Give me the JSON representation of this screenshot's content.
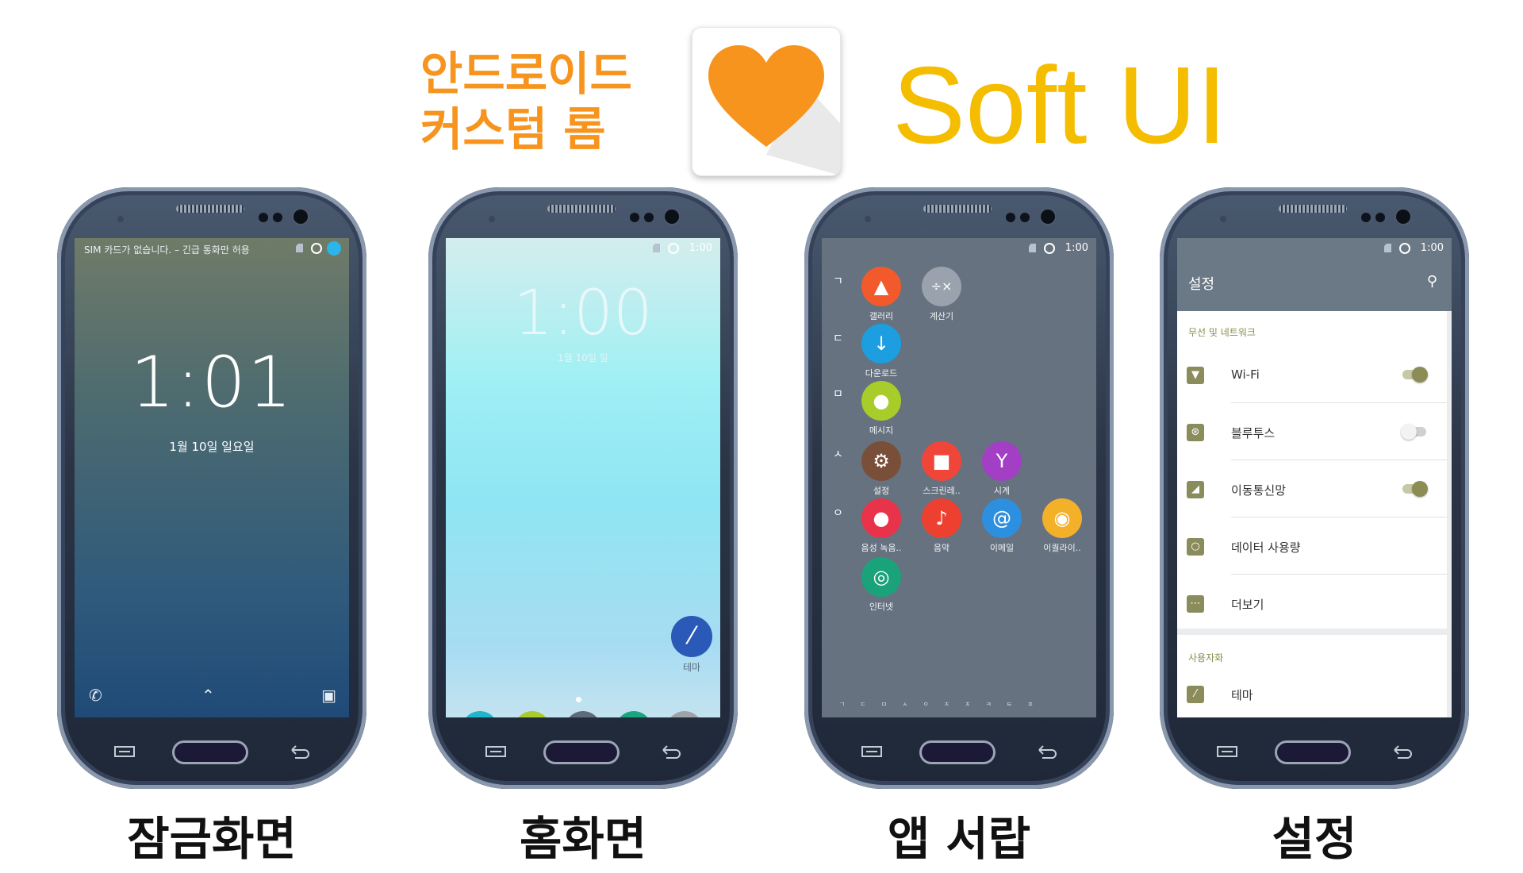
{
  "header": {
    "subtitle_line1": "안드로이드",
    "subtitle_line2": "커스텀 롬",
    "brand": "Soft UI",
    "logo_icon": "heart-icon",
    "accent_orange": "#f7941d",
    "brand_yellow": "#f5bd00"
  },
  "phones": [
    {
      "caption": "잠금화면",
      "lock": {
        "notice": "SIM 카드가 없습니다. – 긴급 통화만 허용",
        "time": "1:01",
        "date": "1월 10일 일요일"
      }
    },
    {
      "caption": "홈화면",
      "status_time": "1:00",
      "home": {
        "time": "1:00",
        "date": "1월 10일 일",
        "theme_label": "테마",
        "dock": [
          "phone-icon",
          "message-icon",
          "apps-icon",
          "browser-icon",
          "camera-icon"
        ]
      }
    },
    {
      "caption": "앱 서랍",
      "status_time": "1:00",
      "drawer": {
        "index": [
          "ㄱ",
          "ㄷ",
          "ㅁ",
          "ㅅ",
          "ㅇ"
        ],
        "apps": [
          {
            "label": "갤러리",
            "color": "#f25a2b"
          },
          {
            "label": "계산기",
            "color": "#9aa3ad"
          },
          {
            "label": "다운로드",
            "color": "#1c9ee0"
          },
          {
            "label": "메시지",
            "color": "#a8cc2a"
          },
          {
            "label": "설정",
            "color": "#7a4f3a"
          },
          {
            "label": "스크린레..",
            "color": "#f0463a"
          },
          {
            "label": "시계",
            "color": "#a23fc4"
          },
          {
            "label": "음성 녹음..",
            "color": "#e8334a"
          },
          {
            "label": "음악",
            "color": "#ee4030"
          },
          {
            "label": "이메일",
            "color": "#2d8fe0"
          },
          {
            "label": "이퀄라이..",
            "color": "#f3b12a"
          },
          {
            "label": "인터넷",
            "color": "#1aa37a"
          }
        ],
        "strip": "ㄱㄷㅁㅅㅇㅈㅊㅋㅌㅍ"
      }
    },
    {
      "caption": "설정",
      "status_time": "1:00",
      "settings": {
        "title": "설정",
        "section1": "무선 및 네트워크",
        "rows": [
          "Wi-Fi",
          "블루투스",
          "이동통신망",
          "데이터 사용량",
          "더보기"
        ],
        "toggles": [
          "on",
          "off",
          "on"
        ],
        "section2": "사용자화",
        "row_theme": "테마"
      }
    }
  ]
}
